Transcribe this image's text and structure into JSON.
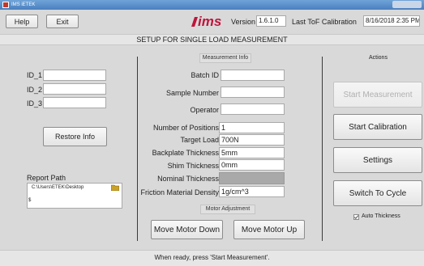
{
  "window": {
    "title": "IMS iETEK"
  },
  "toolbar": {
    "help_label": "Help",
    "exit_label": "Exit",
    "logo_text": "ims",
    "version_label": "Version",
    "version_value": "1.6.1.0",
    "calibration_label": "Last ToF Calibration",
    "calibration_value": "8/16/2018 2:35 PM"
  },
  "header": {
    "title": "SETUP FOR SINGLE LOAD MEASUREMENT"
  },
  "left": {
    "ids": [
      {
        "label": "ID_1",
        "value": ""
      },
      {
        "label": "ID_2",
        "value": ""
      },
      {
        "label": "ID_3",
        "value": ""
      }
    ],
    "restore_label": "Restore Info",
    "report_path_label": "Report Path",
    "report_path_value": "C:\\Users\\ETEK\\Desktop",
    "report_path_prefix": "$"
  },
  "middle": {
    "section_title": "Measurement Info",
    "fields": [
      {
        "label": "Batch ID",
        "value": ""
      },
      {
        "label": "Sample Number",
        "value": ""
      },
      {
        "label": "Operator",
        "value": ""
      }
    ],
    "params": [
      {
        "label": "Number of Positions",
        "value": "1"
      },
      {
        "label": "Target Load",
        "value": "700N"
      },
      {
        "label": "Backplate Thickness",
        "value": "5mm"
      },
      {
        "label": "Shim Thickness",
        "value": "0mm"
      },
      {
        "label": "Nominal Thickness",
        "value": ""
      },
      {
        "label": "Friction Material Density",
        "value": "1g/cm^3"
      }
    ],
    "motor_title": "Motor Adjustment",
    "move_down_label": "Move Motor Down",
    "move_up_label": "Move Motor Up"
  },
  "right": {
    "section_title": "Actions",
    "start_measurement_label": "Start Measurement",
    "start_calibration_label": "Start Calibration",
    "settings_label": "Settings",
    "switch_cycle_label": "Switch To Cycle",
    "auto_thickness_label": "Auto Thickness",
    "auto_thickness_checked": true
  },
  "footer": {
    "status": "When ready, press 'Start Measurement'."
  },
  "colors": {
    "logo_red": "#c0143c",
    "disabled_text": "#b0b0b0"
  }
}
